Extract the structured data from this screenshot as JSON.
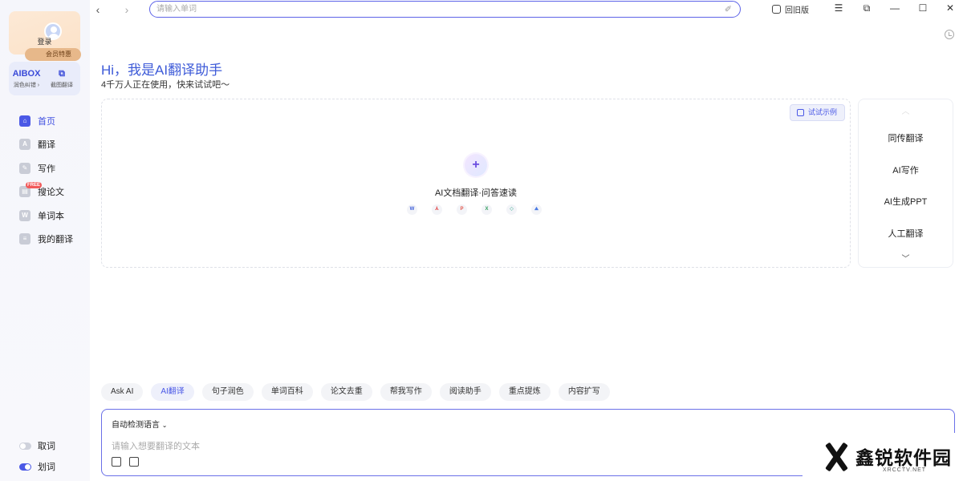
{
  "topbar": {
    "back_icon": "chevron-left-icon",
    "forward_icon": "chevron-right-icon",
    "search_placeholder": "请输入单词",
    "search_value": "",
    "old_version_label": "回旧版",
    "window_buttons": [
      "menu-icon",
      "restore-window-icon",
      "minimize-icon",
      "maximize-icon",
      "close-icon"
    ]
  },
  "sidebar": {
    "login_label": "登录",
    "vip_label": "会员特惠",
    "tools": [
      {
        "icon_text": "AIBOX",
        "label": "润色纠错 ›"
      },
      {
        "icon_text": "⧉",
        "label": "截图翻译"
      }
    ],
    "nav_items": [
      {
        "label": "首页",
        "icon": "home-icon",
        "active": true
      },
      {
        "label": "翻译",
        "icon": "translate-icon",
        "active": false
      },
      {
        "label": "写作",
        "icon": "pen-icon",
        "active": false
      },
      {
        "label": "搜论文",
        "icon": "paper-icon",
        "active": false,
        "badge": "FREE"
      },
      {
        "label": "单词本",
        "icon": "wordbook-icon",
        "active": false
      },
      {
        "label": "我的翻译",
        "icon": "my-translation-icon",
        "active": false
      }
    ],
    "toggles": [
      {
        "label": "取词",
        "on": false
      },
      {
        "label": "划词",
        "on": true
      }
    ]
  },
  "hero": {
    "title": "Hi，我是AI翻译助手",
    "subtitle": "4千万人正在使用，快来试试吧～"
  },
  "upload": {
    "try_example": "试试示例",
    "title": "AI文档翻译·问答速读",
    "file_types": [
      {
        "letter": "W",
        "color": "#3a5bd9"
      },
      {
        "letter": "⅄",
        "color": "#e34b4b"
      },
      {
        "letter": "P",
        "color": "#e3574b"
      },
      {
        "letter": "X",
        "color": "#2f9e5a"
      },
      {
        "letter": "◇",
        "color": "#2fa889"
      },
      {
        "letter": "⛰",
        "color": "#4b7be3"
      }
    ]
  },
  "right_panel": {
    "items": [
      "同传翻译",
      "AI写作",
      "AI生成PPT",
      "人工翻译"
    ]
  },
  "chips": [
    {
      "label": "Ask AI",
      "active": false
    },
    {
      "label": "AI翻译",
      "active": true
    },
    {
      "label": "句子润色",
      "active": false
    },
    {
      "label": "单词百科",
      "active": false
    },
    {
      "label": "论文去重",
      "active": false
    },
    {
      "label": "帮我写作",
      "active": false
    },
    {
      "label": "阅读助手",
      "active": false
    },
    {
      "label": "重点提炼",
      "active": false
    },
    {
      "label": "内容扩写",
      "active": false
    }
  ],
  "input": {
    "language_select": "自动检测语言",
    "placeholder": "请输入想要翻译的文本"
  },
  "watermark": {
    "text": "鑫锐软件园",
    "sub": "XRCCTV.NET"
  }
}
